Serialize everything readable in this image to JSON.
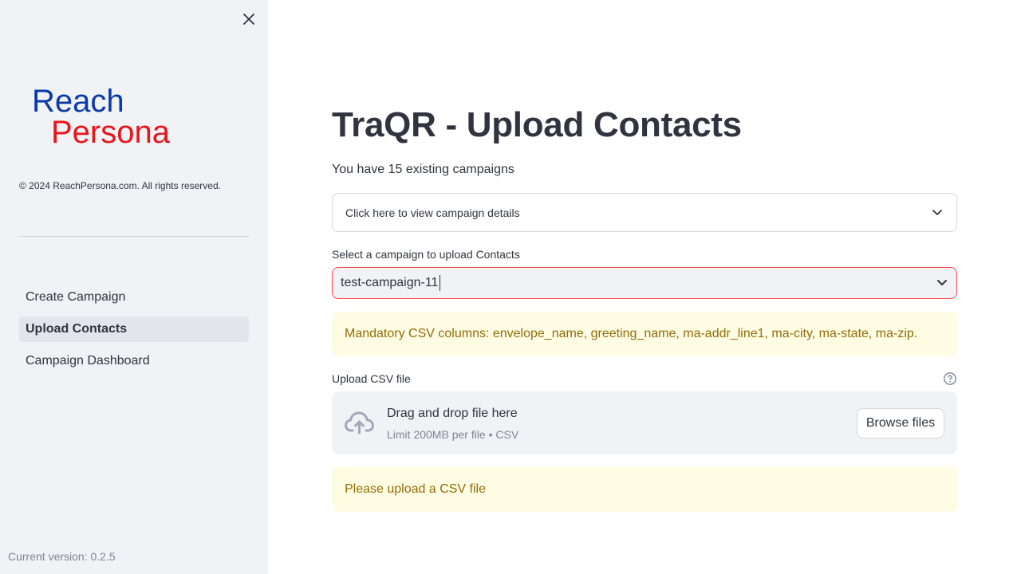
{
  "sidebar": {
    "logo": {
      "line1": "Reach",
      "line2": "Persona",
      "color1": "#0a3aa6",
      "color2": "#e8161b"
    },
    "copyright": "© 2024 ReachPersona.com. All rights reserved.",
    "nav": [
      {
        "label": "Create Campaign",
        "active": false
      },
      {
        "label": "Upload Contacts",
        "active": true
      },
      {
        "label": "Campaign Dashboard",
        "active": false
      }
    ],
    "version": "Current version: 0.2.5"
  },
  "main": {
    "title": "TraQR - Upload Contacts",
    "subtext": "You have 15 existing campaigns",
    "expander_label": "Click here to view campaign details",
    "select": {
      "label": "Select a campaign to upload Contacts",
      "value": "test-campaign-11"
    },
    "alert_columns": "Mandatory CSV columns: envelope_name, greeting_name, ma-addr_line1, ma-city, ma-state, ma-zip.",
    "upload": {
      "label": "Upload CSV file",
      "drag_text": "Drag and drop file here",
      "limit_text": "Limit 200MB per file • CSV",
      "browse_label": "Browse files"
    },
    "alert_upload": "Please upload a CSV file"
  },
  "colors": {
    "sidebar_bg": "#f0f2f6",
    "accent_red": "#ff4b4b",
    "warning_bg": "#fffce4",
    "warning_text": "#926c05"
  },
  "icons": [
    "close-icon",
    "chevron-down-icon",
    "help-icon",
    "cloud-upload-icon"
  ]
}
